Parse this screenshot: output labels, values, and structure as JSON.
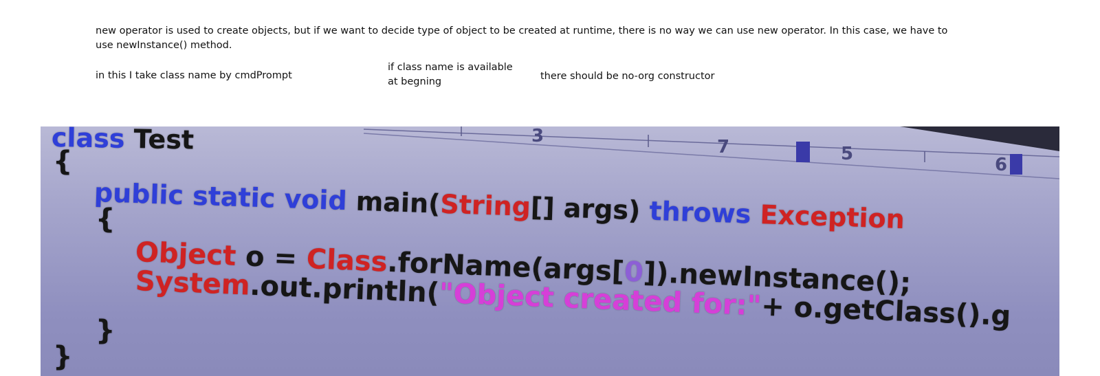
{
  "notes": {
    "paragraph": "new operator is used to create objects, but if we want to decide type of object to be created at runtime, there is no way we can use new operator. In this case, we have to use newInstance() method.",
    "note_1": "in this I take class name by cmdPrompt",
    "note_2": "if class name is available at begning",
    "note_3": "there should be no-org constructor"
  },
  "code_image": {
    "ruler_numbers": [
      "3",
      "7",
      "5",
      "6"
    ],
    "line_1": {
      "keyword": "class",
      "name": "Test"
    },
    "line_2": {
      "brace": "{"
    },
    "line_3": {
      "kw1": "public",
      "kw2": "static",
      "kw3": "void",
      "method": "main(",
      "type": "String",
      "args": "[] args)",
      "kw_throws": "throws",
      "exception": "Exception"
    },
    "line_4": {
      "brace": "{"
    },
    "line_5": {
      "type": "Object",
      "assign": "o =",
      "cls": "Class",
      "call_a": ".forName(args[",
      "index": "0",
      "call_b": "]).newInstance();"
    },
    "line_6": {
      "type": "System",
      "call": ".out.println(",
      "string": "\"Object created for:\"",
      "rest": "+ o.getClass().g"
    },
    "line_7": {
      "brace": "}"
    },
    "line_8": {
      "brace": "}"
    },
    "colors": {
      "keyword": "#2f3fd8",
      "type": "#cf2323",
      "string": "#d63fd8",
      "number": "#8d5fd6",
      "text": "#161616",
      "background": "#9d9dc8"
    }
  }
}
